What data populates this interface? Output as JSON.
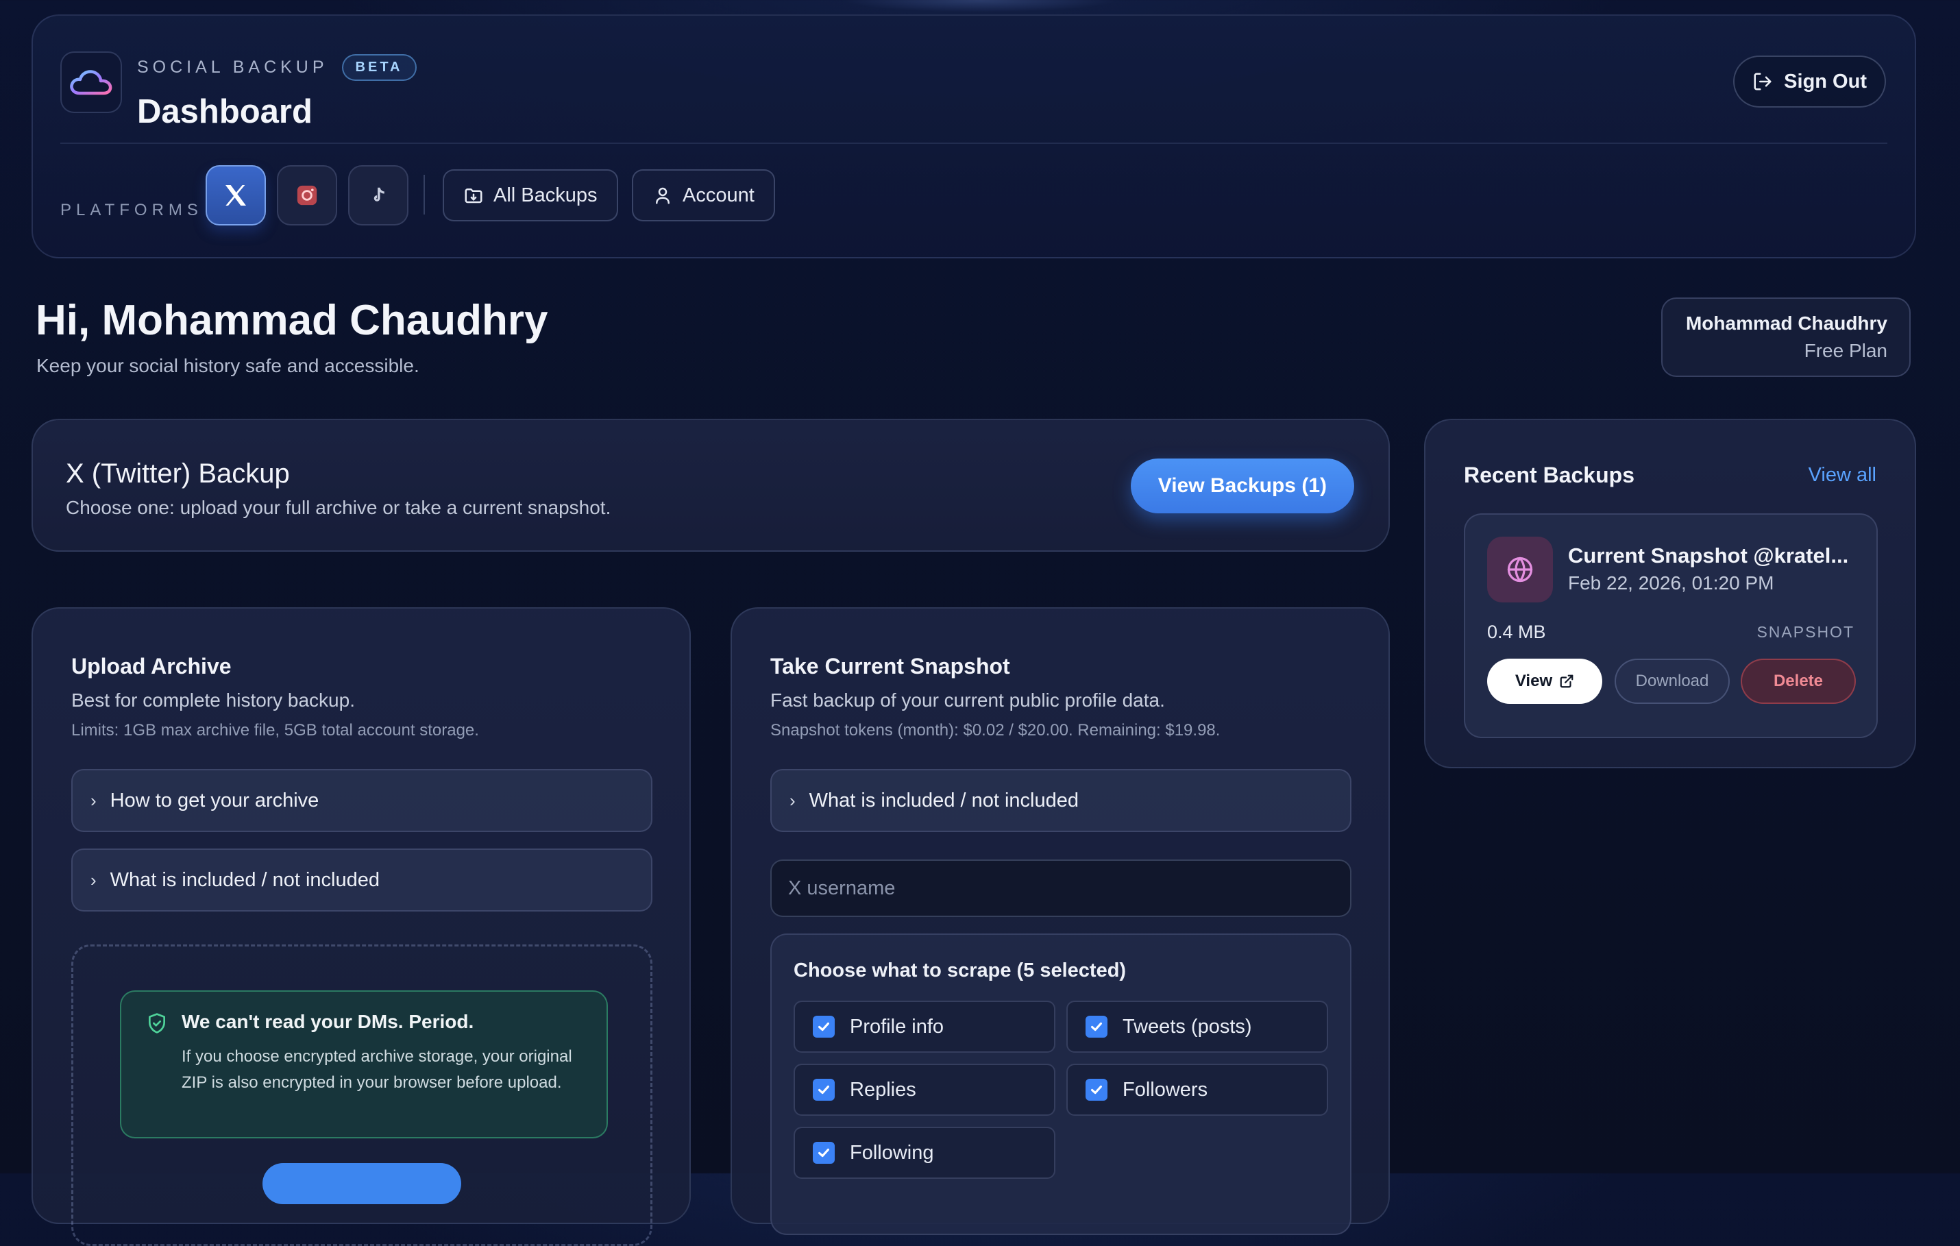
{
  "header": {
    "brand_name": "SOCIAL BACKUP",
    "beta_badge": "BETA",
    "title": "Dashboard",
    "sign_out_label": "Sign Out",
    "platforms_label": "PLATFORMS",
    "platforms": [
      {
        "name": "X",
        "icon": "x-logo-icon",
        "active": true
      },
      {
        "name": "Instagram",
        "icon": "instagram-icon",
        "active": false
      },
      {
        "name": "TikTok",
        "icon": "tiktok-icon",
        "active": false
      }
    ],
    "nav": {
      "all_backups_label": "All Backups",
      "account_label": "Account"
    }
  },
  "greeting": {
    "title": "Hi, Mohammad Chaudhry",
    "subtitle": "Keep your social history safe and accessible."
  },
  "user_card": {
    "name": "Mohammad Chaudhry",
    "plan": "Free Plan"
  },
  "backup_card": {
    "title": "X (Twitter) Backup",
    "subtitle": "Choose one: upload your full archive or take a current snapshot.",
    "view_backups_label": "View Backups (1)"
  },
  "recent_backups": {
    "title": "Recent Backups",
    "view_all_label": "View all",
    "items": [
      {
        "title": "Current Snapshot @kratel...",
        "date": "Feb 22, 2026, 01:20 PM",
        "size": "0.4 MB",
        "type": "SNAPSHOT",
        "view_label": "View",
        "download_label": "Download",
        "delete_label": "Delete"
      }
    ]
  },
  "upload_archive": {
    "title": "Upload Archive",
    "subtitle": "Best for complete history backup.",
    "limits": "Limits: 1GB max archive file, 5GB total account storage.",
    "accordions": [
      "How to get your archive",
      "What is included / not included"
    ],
    "dm_notice": {
      "title": "We can't read your DMs. Period.",
      "text": "If you choose encrypted archive storage, your original ZIP is also encrypted in your browser before upload."
    }
  },
  "snapshot": {
    "title": "Take Current Snapshot",
    "subtitle": "Fast backup of your current public profile data.",
    "tokens": "Snapshot tokens (month): $0.02 / $20.00. Remaining: $19.98.",
    "accordions": [
      "What is included / not included"
    ],
    "username_placeholder": "X username",
    "scrape_title": "Choose what to scrape (5 selected)",
    "options": [
      {
        "label": "Profile info",
        "checked": true
      },
      {
        "label": "Tweets (posts)",
        "checked": true
      },
      {
        "label": "Replies",
        "checked": true
      },
      {
        "label": "Followers",
        "checked": true
      },
      {
        "label": "Following",
        "checked": true
      }
    ]
  },
  "colors": {
    "accent_blue": "#3b82f6",
    "link_blue": "#5aa3ff",
    "success_green": "#3cb482",
    "danger_red": "#f08a94",
    "background": "#0a1128"
  }
}
